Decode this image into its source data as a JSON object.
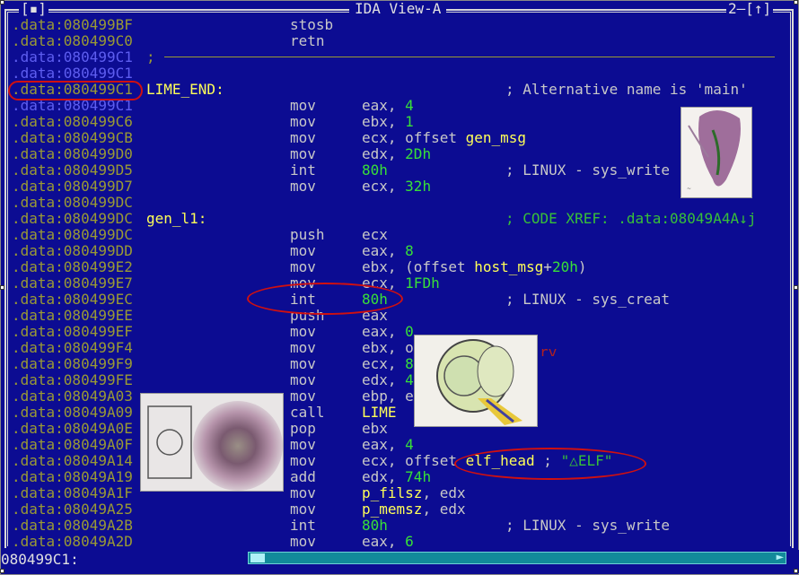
{
  "window": {
    "title": "IDA View-A",
    "close_box": "[▪]",
    "window_number": "2–[↑]",
    "status_address": "080499C1:"
  },
  "lines": [
    {
      "addr": ".data:080499BF",
      "mnem": "stosb",
      "op": "",
      "comment": ""
    },
    {
      "addr": ".data:080499C0",
      "mnem": "retn",
      "op": "",
      "comment": ""
    },
    {
      "addr": ".data:080499C1",
      "label": ";",
      "mnem": "",
      "op": "",
      "comment": ""
    },
    {
      "addr": ".data:080499C1",
      "mnem": "",
      "op": "",
      "comment": ""
    },
    {
      "addr": ".data:080499C1",
      "label": "LIME_END:",
      "mnem": "",
      "op": "",
      "comment": "; Alternative name is 'main'"
    },
    {
      "addr": ".data:080499C1",
      "mnem": "mov",
      "op": "eax, 4",
      "comment": ""
    },
    {
      "addr": ".data:080499C6",
      "mnem": "mov",
      "op": "ebx, 1",
      "comment": ""
    },
    {
      "addr": ".data:080499CB",
      "mnem": "mov",
      "op": "ecx, offset gen_msg",
      "comment": ""
    },
    {
      "addr": ".data:080499D0",
      "mnem": "mov",
      "op": "edx, 2Dh",
      "comment": ""
    },
    {
      "addr": ".data:080499D5",
      "mnem": "int",
      "op": "80h",
      "comment": "; LINUX - sys_write"
    },
    {
      "addr": ".data:080499D7",
      "mnem": "mov",
      "op": "ecx, 32h",
      "comment": ""
    },
    {
      "addr": ".data:080499DC",
      "mnem": "",
      "op": "",
      "comment": ""
    },
    {
      "addr": ".data:080499DC",
      "label": "gen_l1:",
      "mnem": "",
      "op": "",
      "comment": "; CODE XREF: .data:08049A4A↓j"
    },
    {
      "addr": ".data:080499DC",
      "mnem": "push",
      "op": "ecx",
      "comment": ""
    },
    {
      "addr": ".data:080499DD",
      "mnem": "mov",
      "op": "eax, 8",
      "comment": ""
    },
    {
      "addr": ".data:080499E2",
      "mnem": "mov",
      "op": "ebx, (offset host_msg+20h)",
      "comment": ""
    },
    {
      "addr": ".data:080499E7",
      "mnem": "mov",
      "op": "ecx, 1FDh",
      "comment": ""
    },
    {
      "addr": ".data:080499EC",
      "mnem": "int",
      "op": "80h",
      "comment": "; LINUX - sys_creat"
    },
    {
      "addr": ".data:080499EE",
      "mnem": "push",
      "op": "eax",
      "comment": ""
    },
    {
      "addr": ".data:080499EF",
      "mnem": "mov",
      "op": "eax, 0",
      "comment": ""
    },
    {
      "addr": ".data:080499F4",
      "mnem": "mov",
      "op": "ebx, o",
      "comment": ""
    },
    {
      "addr": ".data:080499F9",
      "mnem": "mov",
      "op": "ecx, 8",
      "comment": ""
    },
    {
      "addr": ".data:080499FE",
      "mnem": "mov",
      "op": "edx, 4",
      "comment": ""
    },
    {
      "addr": ".data:08049A03",
      "mnem": "mov",
      "op": "ebp, e",
      "comment": ""
    },
    {
      "addr": ".data:08049A09",
      "mnem": "call",
      "op": "LIME",
      "comment": ""
    },
    {
      "addr": ".data:08049A0E",
      "mnem": "pop",
      "op": "ebx",
      "comment": ""
    },
    {
      "addr": ".data:08049A0F",
      "mnem": "mov",
      "op": "eax, 4",
      "comment": ""
    },
    {
      "addr": ".data:08049A14",
      "mnem": "mov",
      "op": "ecx, offset elf_head ; \"△ELF\"",
      "comment": ""
    },
    {
      "addr": ".data:08049A19",
      "mnem": "add",
      "op": "edx, 74h",
      "comment": ""
    },
    {
      "addr": ".data:08049A1F",
      "mnem": "mov",
      "op": "p_filsz, edx",
      "comment": ""
    },
    {
      "addr": ".data:08049A25",
      "mnem": "mov",
      "op": "p_memsz, edx",
      "comment": ""
    },
    {
      "addr": ".data:08049A2B",
      "mnem": "int",
      "op": "80h",
      "comment": "; LINUX - sys_write"
    },
    {
      "addr": ".data:08049A2D",
      "mnem": "mov",
      "op": "eax, 6",
      "comment": ""
    }
  ],
  "colors": {
    "background": "#0c0c92",
    "address": "#9a9a34",
    "address_highlight": "#5e5ef0",
    "label": "#ffff58",
    "number": "#38e038",
    "annotation_ring": "#d01010"
  },
  "overlay_photos": [
    "anatomy-sketch-1",
    "disc-drawing",
    "eye-sketch",
    "anatomy-sketch-2"
  ],
  "partial_overlay_text": "ry"
}
